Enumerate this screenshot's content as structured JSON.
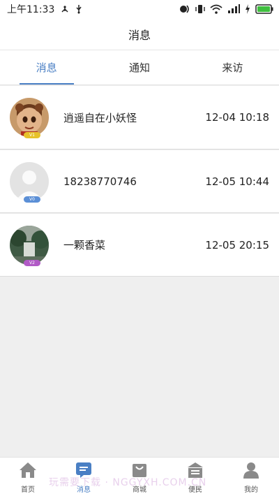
{
  "status_bar": {
    "time": "上午11:33"
  },
  "header": {
    "title": "消息"
  },
  "tabs": [
    {
      "label": "消息",
      "active": true
    },
    {
      "label": "通知",
      "active": false
    },
    {
      "label": "来访",
      "active": false
    }
  ],
  "messages": [
    {
      "name": "逍遥自在小妖怪",
      "time": "12-04 10:18",
      "badge": "V1",
      "badge_color": "#e7c22a"
    },
    {
      "name": "18238770746",
      "time": "12-05 10:44",
      "badge": "V0",
      "badge_color": "#5b8fd6"
    },
    {
      "name": "一颗香菜",
      "time": "12-05 20:15",
      "badge": "V2",
      "badge_color": "#b15ac6"
    }
  ],
  "bottom_nav": [
    {
      "label": "首页",
      "icon": "home-icon",
      "active": false
    },
    {
      "label": "消息",
      "icon": "message-icon",
      "active": true
    },
    {
      "label": "商城",
      "icon": "shop-icon",
      "active": false
    },
    {
      "label": "便民",
      "icon": "convenience-icon",
      "active": false
    },
    {
      "label": "我的",
      "icon": "profile-icon",
      "active": false
    }
  ],
  "watermark": "玩需要下载 · NGGYXH.COM.CN",
  "colors": {
    "accent": "#4a7fc4",
    "background": "#efefef"
  }
}
